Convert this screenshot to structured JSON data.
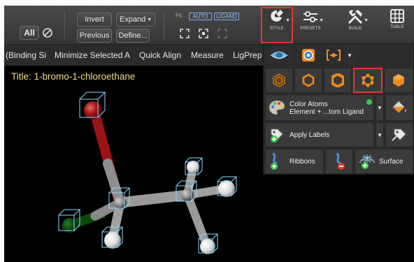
{
  "toolbar": {
    "all_label": "All",
    "invert_label": "Invert",
    "expand_label": "Expand",
    "previous_label": "Previous",
    "define_label": "Define...",
    "fit_label": "Fit:",
    "fit_auto": "AUTO",
    "fit_ligand": "LIGAND",
    "style_label": "STYLE",
    "presets_label": "PRESETS",
    "build_label": "BUILD",
    "table_label": "TABLE"
  },
  "menubar": {
    "items": [
      "(Binding Si",
      "Minimize Selected A",
      "Quick Align",
      "Measure",
      "LigPrep"
    ]
  },
  "viewport": {
    "title": "Title: 1-bromo-1-chloroethane"
  },
  "style_panel": {
    "color_atoms_line1": "Color Atoms",
    "color_atoms_line2": "Element + ...tom Ligand",
    "apply_labels": "Apply Labels",
    "ribbons": "Ribbons",
    "surface": "Surface"
  },
  "icons": {
    "style": "style-icon",
    "presets": "presets-icon",
    "build": "build-icon",
    "table": "table-icon"
  },
  "colors": {
    "accent_orange": "#f08a1c",
    "highlight_red": "#e03a2a",
    "title_yellow": "#f2df8e",
    "status_green": "#2ecc40"
  }
}
